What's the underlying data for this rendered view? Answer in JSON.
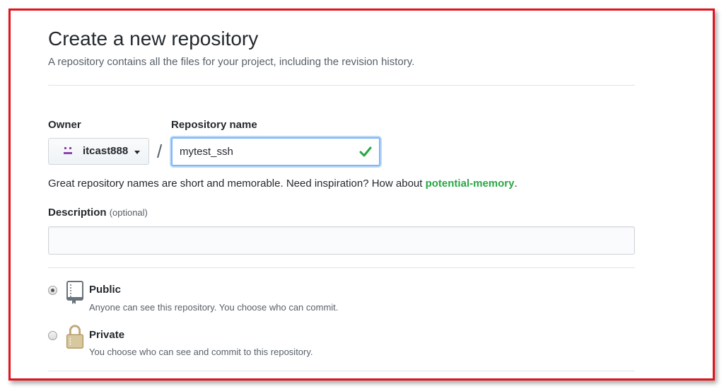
{
  "header": {
    "title": "Create a new repository",
    "subtitle": "A repository contains all the files for your project, including the revision history."
  },
  "owner": {
    "label": "Owner",
    "value": "itcast888",
    "avatar": "identicon-icon"
  },
  "separator": "/",
  "repository": {
    "label": "Repository name",
    "value": "mytest_ssh",
    "status_icon": "check-icon",
    "status_color": "#28a745"
  },
  "hint": {
    "text": "Great repository names are short and memorable. Need inspiration? How about ",
    "suggestion": "potential-memory",
    "end": "."
  },
  "description": {
    "label": "Description",
    "optional": "(optional)",
    "value": ""
  },
  "visibility": {
    "selected": "public",
    "options": [
      {
        "id": "public",
        "title": "Public",
        "desc": "Anyone can see this repository. You choose who can commit.",
        "icon": "repo-book-icon"
      },
      {
        "id": "private",
        "title": "Private",
        "desc": "You choose who can see and commit to this repository.",
        "icon": "lock-icon"
      }
    ]
  },
  "colors": {
    "accent_link": "#28a745",
    "focus_border": "#79b8ff",
    "frame_border": "#e0141e"
  }
}
